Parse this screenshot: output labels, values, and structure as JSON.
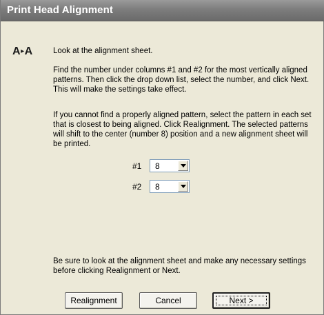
{
  "window": {
    "title": "Print Head Alignment"
  },
  "content": {
    "logo_text": "A",
    "logo_text2": "A",
    "instruction_1": "Look at the alignment sheet.",
    "instruction_2": "Find the number under columns #1 and #2 for the most vertically aligned patterns. Then click the drop down list, select the number, and click Next. This will make the settings take effect.",
    "instruction_3": "If you cannot find a properly aligned pattern, select the pattern in each set that is closest to being aligned. Click Realignment. The selected patterns will shift to the center (number 8) position and a new alignment sheet will be printed.",
    "instruction_4": "Be sure to look at the alignment sheet and make any necessary settings before clicking Realignment or Next."
  },
  "fields": [
    {
      "label": "#1",
      "value": "8"
    },
    {
      "label": "#2",
      "value": "8"
    }
  ],
  "buttons": {
    "realignment": "Realignment",
    "cancel": "Cancel",
    "next": "Next >"
  }
}
